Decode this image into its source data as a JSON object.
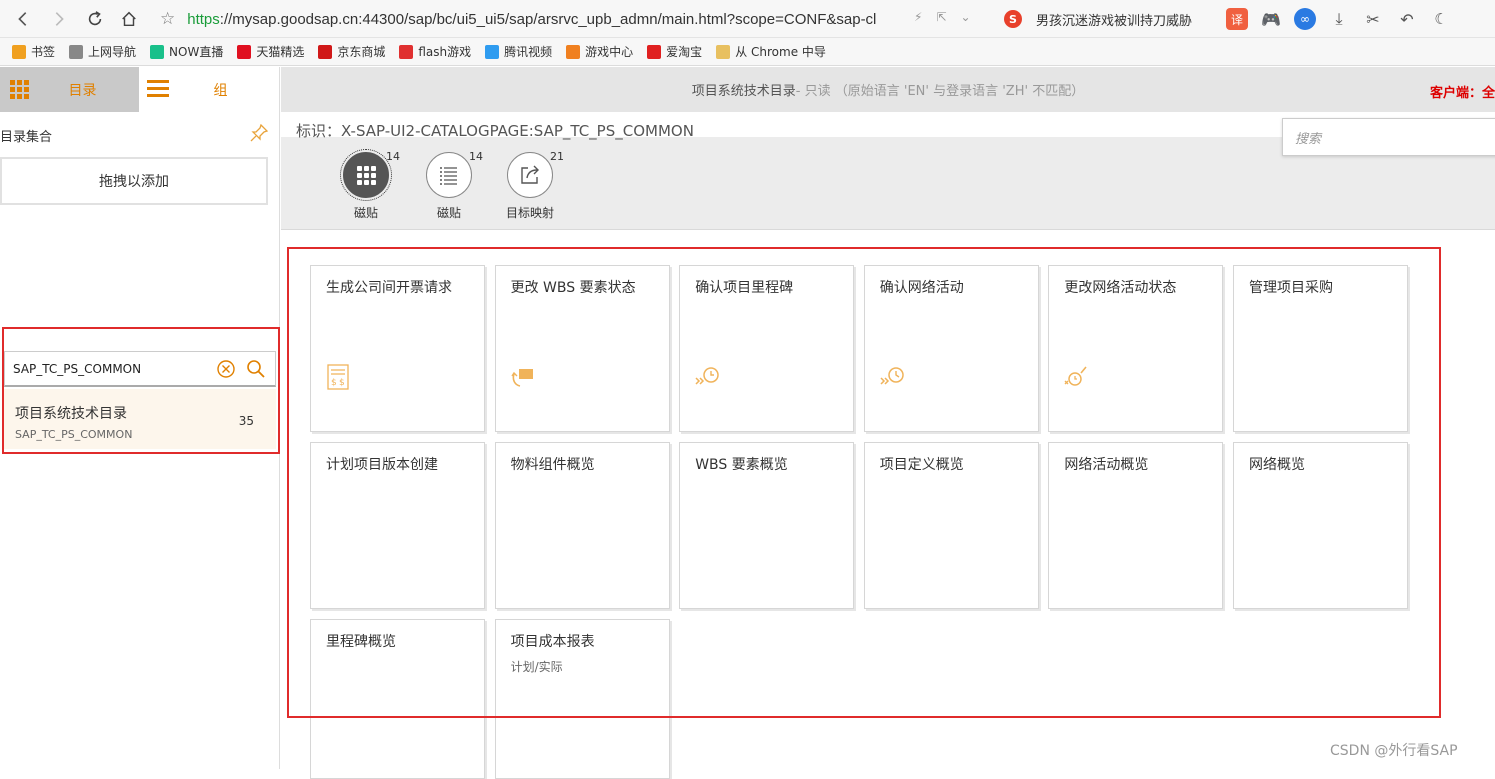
{
  "browser": {
    "url_scheme": "https",
    "url_rest": "://mysap.goodsap.cn:44300/sap/bc/ui5_ui5/sap/arsrvc_upb_admn/main.html?scope=CONF&sap-cl",
    "search_engine_text": "男孩沉迷游戏被训持刀威胁"
  },
  "bookmarks": [
    {
      "label": "书签",
      "color": "#f0a020"
    },
    {
      "label": "上网导航",
      "color": "#888888"
    },
    {
      "label": "NOW直播",
      "color": "#19c08a"
    },
    {
      "label": "天猫精选",
      "color": "#e01020"
    },
    {
      "label": "京东商城",
      "color": "#d01818"
    },
    {
      "label": "flash游戏",
      "color": "#e03030"
    },
    {
      "label": "腾讯视频",
      "color": "#2f9cf0"
    },
    {
      "label": "游戏中心",
      "color": "#f08020"
    },
    {
      "label": "爱淘宝",
      "color": "#e02020"
    },
    {
      "label": "从 Chrome 中导",
      "color": "#e8c060"
    }
  ],
  "left": {
    "tab_catalog": "目录",
    "tab_group": "组",
    "catalog_set_label": "目录集合",
    "drag_add": "拖拽以添加",
    "search_value": "SAP_TC_PS_COMMON",
    "catalog_item": {
      "title": "项目系统技术目录",
      "subtitle": "SAP_TC_PS_COMMON",
      "count": "35"
    }
  },
  "main": {
    "header_title": "项目系统技术目录",
    "header_readonly": " - 只读 （原始语言 'EN' 与登录语言 'ZH' 不匹配）",
    "client_label": "客户端：全",
    "identity": "标识：X-SAP-UI2-CATALOGPAGE:SAP_TC_PS_COMMON",
    "search_placeholder": "搜索",
    "icon_tabs": [
      {
        "label": "磁贴",
        "count": "14",
        "icon": "grid-icon",
        "selected": true
      },
      {
        "label": "磁贴",
        "count": "14",
        "icon": "list-icon",
        "selected": false
      },
      {
        "label": "目标映射",
        "count": "21",
        "icon": "share-icon",
        "selected": false
      }
    ],
    "tiles": [
      {
        "title": "生成公司间开票请求",
        "subtitle": "",
        "icon": "invoice-icon"
      },
      {
        "title": "更改 WBS 要素状态",
        "subtitle": "",
        "icon": "status-change-icon"
      },
      {
        "title": "确认项目里程碑",
        "subtitle": "",
        "icon": "milestone-confirm-icon"
      },
      {
        "title": "确认网络活动",
        "subtitle": "",
        "icon": "activity-confirm-icon"
      },
      {
        "title": "更改网络活动状态",
        "subtitle": "",
        "icon": "activity-status-icon"
      },
      {
        "title": "管理项目采购",
        "subtitle": "",
        "icon": ""
      },
      {
        "title": "计划项目版本创建",
        "subtitle": "",
        "icon": ""
      },
      {
        "title": "物料组件概览",
        "subtitle": "",
        "icon": ""
      },
      {
        "title": "WBS 要素概览",
        "subtitle": "",
        "icon": ""
      },
      {
        "title": "项目定义概览",
        "subtitle": "",
        "icon": ""
      },
      {
        "title": "网络活动概览",
        "subtitle": "",
        "icon": ""
      },
      {
        "title": "网络概览",
        "subtitle": "",
        "icon": ""
      },
      {
        "title": "里程碑概览",
        "subtitle": "",
        "icon": ""
      },
      {
        "title": "项目成本报表",
        "subtitle": "计划/实际",
        "icon": ""
      }
    ]
  },
  "watermark": "CSDN @外行看SAP",
  "colors": {
    "accent": "#e08000",
    "highlight": "#e02b2b",
    "tile_icon": "#f0b35a"
  }
}
